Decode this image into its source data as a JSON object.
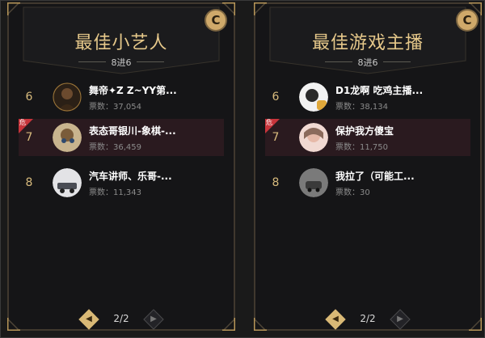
{
  "panels": [
    {
      "title": "最佳小艺人",
      "subtitle": "8进6",
      "badge": "C",
      "rows": [
        {
          "rank": "6",
          "name": "舞帝✦Z Z~YY第...",
          "votes": "票数：37,054",
          "danger": false
        },
        {
          "rank": "7",
          "name": "表态哥银川-象棋-...",
          "votes": "票数：36,459",
          "danger": true,
          "danger_label": "危"
        },
        {
          "rank": "8",
          "name": "汽车讲师、乐哥-...",
          "votes": "票数：11,343",
          "danger": false
        }
      ],
      "pager": {
        "text": "2/2"
      }
    },
    {
      "title": "最佳游戏主播",
      "subtitle": "8进6",
      "badge": "C",
      "rows": [
        {
          "rank": "6",
          "name": "D1龙啊 吃鸡主播...",
          "votes": "票数：38,134",
          "danger": false
        },
        {
          "rank": "7",
          "name": "保护我方傻宝",
          "votes": "票数：11,750",
          "danger": true,
          "danger_label": "危"
        },
        {
          "rank": "8",
          "name": "我拉了（可能工...",
          "votes": "票数：30",
          "danger": false
        }
      ],
      "pager": {
        "text": "2/2"
      }
    }
  ],
  "colors": {
    "gold": "#e6c88a",
    "highlight": "#2a1a1f",
    "danger": "#c7343b"
  },
  "icons": {
    "badge": "c-badge-icon",
    "prev": "chevron-left-icon",
    "next": "chevron-right-icon"
  }
}
